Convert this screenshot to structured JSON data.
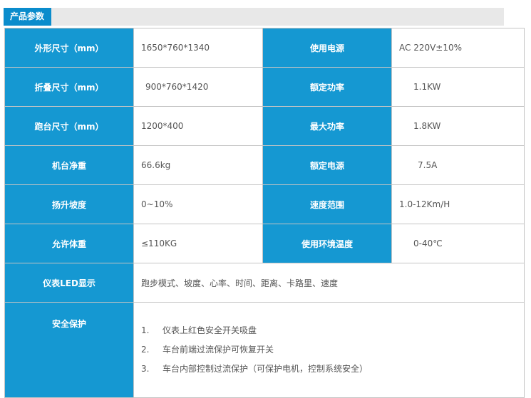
{
  "header": {
    "title": "产品参数"
  },
  "rows": [
    {
      "l1": "外形尺寸（mm）",
      "v1": "1650*760*1340",
      "l2": "使用电源",
      "v2": "AC 220V±10%"
    },
    {
      "l1": "折叠尺寸（mm）",
      "v1": "900*760*1420",
      "l2": "额定功率",
      "v2": "1.1KW"
    },
    {
      "l1": "跑台尺寸（mm）",
      "v1": "1200*400",
      "l2": "最大功率",
      "v2": "1.8KW"
    },
    {
      "l1": "机台净重",
      "v1": "66.6kg",
      "l2": "额定电源",
      "v2": "7.5A"
    },
    {
      "l1": "扬升坡度",
      "v1": "0~10%",
      "l2": "速度范围",
      "v2": "1.0-12Km/H"
    },
    {
      "l1": "允许体重",
      "v1": "≤110KG",
      "l2": "使用环境温度",
      "v2": "0-40℃"
    }
  ],
  "display": {
    "label": "仪表LED显示",
    "value": "跑步模式、坡度、心率、时间、距离、卡路里、速度"
  },
  "safety": {
    "label": "安全保护",
    "items": [
      {
        "num": "1.",
        "text": "仪表上红色安全开关吸盘"
      },
      {
        "num": "2.",
        "text": "车台前端过流保护可恢复开关"
      },
      {
        "num": "3.",
        "text": "车台内部控制过流保护（可保护电机，控制系统安全）"
      }
    ]
  }
}
